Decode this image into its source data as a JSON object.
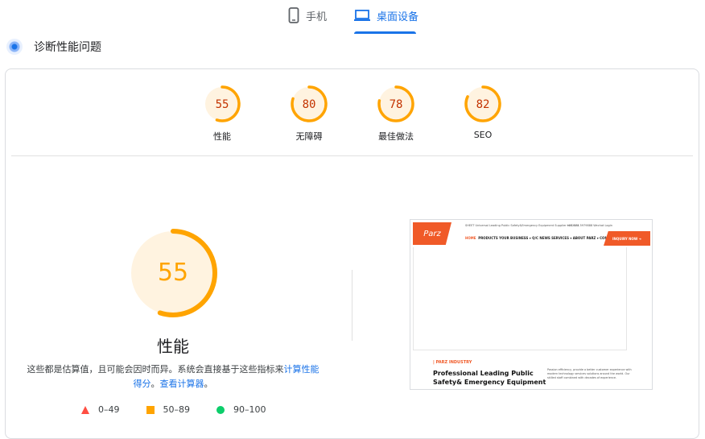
{
  "tabs": {
    "mobile": "手机",
    "desktop": "桌面设备"
  },
  "section_title": "诊断性能问题",
  "scores": [
    {
      "value": "55",
      "label": "性能",
      "color": "#ffa400",
      "text_color": "#c33300",
      "fraction": 0.55
    },
    {
      "value": "80",
      "label": "无障碍",
      "color": "#ffa400",
      "text_color": "#c33300",
      "fraction": 0.8
    },
    {
      "value": "78",
      "label": "最佳做法",
      "color": "#ffa400",
      "text_color": "#c33300",
      "fraction": 0.78
    },
    {
      "value": "82",
      "label": "SEO",
      "color": "#ffa400",
      "text_color": "#c33300",
      "fraction": 0.82
    }
  ],
  "main": {
    "score": "55",
    "score_fraction": 0.55,
    "title": "性能",
    "desc_text": "这些都是估算值，且可能会因时而异。系统会直接基于这些指标来",
    "desc_link1": "计算性能得分",
    "desc_mid": "。",
    "desc_link2": "查看计算器",
    "desc_end": "。"
  },
  "legend": [
    {
      "range": "0–49",
      "shape": "triangle",
      "color": "#ff4e42"
    },
    {
      "range": "50–89",
      "shape": "square",
      "color": "#ffa400"
    },
    {
      "range": "90–100",
      "shape": "circle",
      "color": "#0cce6b"
    }
  ],
  "screenshot": {
    "logo": "Parz",
    "contact": "SHEET Universal Leading Public Safety&Emergency Equipment Supplier in China",
    "contact2": "+86-577-5979888   Wechat   Login",
    "nav_home": "HOME",
    "nav": "PRODUCTS   YOUR BUSINESS ▾   Q/C   NEWS   SERVICES ▾   ABOUT PARZ ▾   CONTACT",
    "enquiry": "INQUIRY NOW  ➜",
    "tag": "| PARZ INDUSTRY",
    "heading1": "Professional Leading Public",
    "heading2": "Safety& Emergency Equipment",
    "paragraph": "Passion efficiency, provide a better customer experience with modern technology services solutions around the world. Our skilled staff combined with decades of experience."
  }
}
